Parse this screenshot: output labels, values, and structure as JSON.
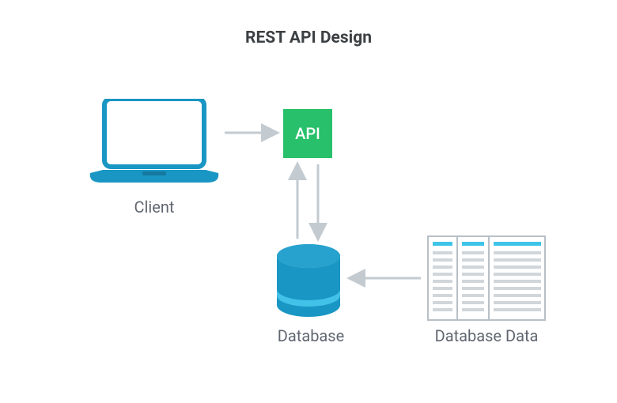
{
  "title": "REST API Design",
  "nodes": {
    "client": {
      "label": "Client"
    },
    "api": {
      "label": "API"
    },
    "database": {
      "label": "Database"
    },
    "database_data": {
      "label": "Database Data"
    }
  },
  "colors": {
    "api_box": "#28c06a",
    "laptop": "#1996c3",
    "db_top": "#27a2cf",
    "db_side": "#1996c3",
    "db_stripe": "#42c2e9",
    "arrow": "#c3cbd1",
    "table_stroke": "#b8c0c6",
    "table_header": "#3fc4e8",
    "table_row": "#d0d6da",
    "text": "#606670"
  },
  "edges": [
    {
      "from": "client",
      "to": "api",
      "direction": "right"
    },
    {
      "from": "api",
      "to": "database",
      "direction": "down"
    },
    {
      "from": "database",
      "to": "api",
      "direction": "up"
    },
    {
      "from": "database_data",
      "to": "database",
      "direction": "left"
    }
  ]
}
